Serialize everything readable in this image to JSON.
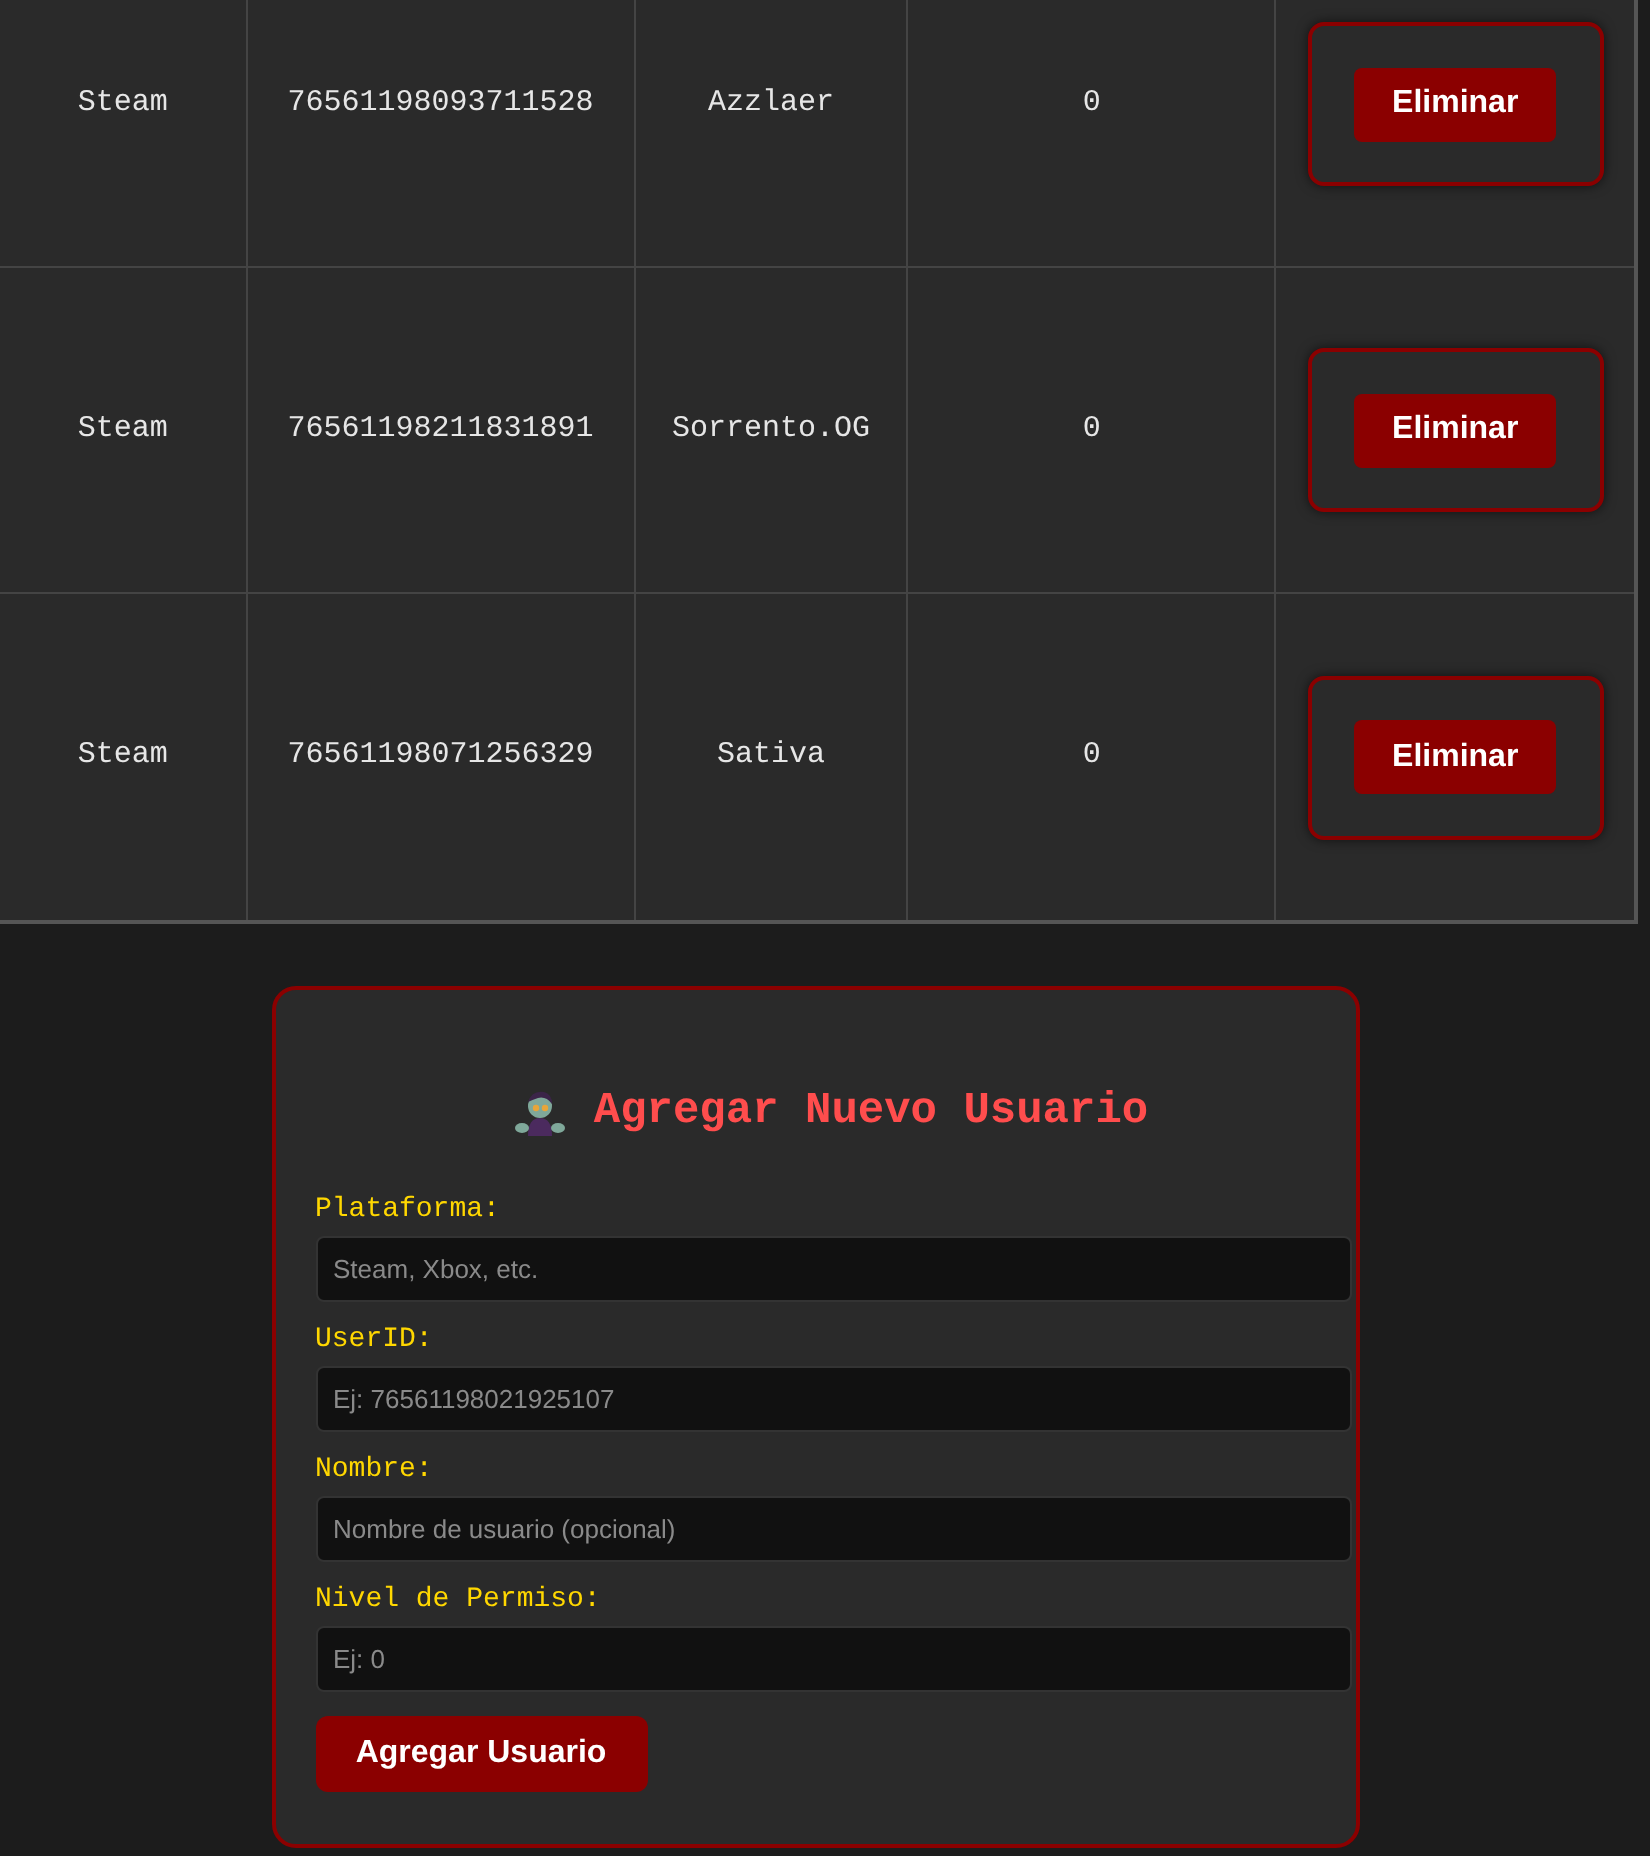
{
  "users": [
    {
      "platform": "Steam",
      "user_id": "76561198093711528",
      "name": "Azzlaer",
      "level_text": "0",
      "action": "Eliminar"
    },
    {
      "platform": "Steam",
      "user_id": "76561198211831891",
      "name": "Sorrento.OG",
      "level_text": "0",
      "action": "Eliminar"
    },
    {
      "platform": "Steam",
      "user_id": "76561198071256329",
      "name": "Sativa",
      "level_text": "0",
      "action": "Eliminar"
    }
  ],
  "form": {
    "title": "Agregar Nuevo Usuario",
    "fields": [
      {
        "label": "Plataforma:",
        "placeholder": "Steam, Xbox, etc."
      },
      {
        "label": "UserID:",
        "placeholder": "Ej: 76561198021925107"
      },
      {
        "label": "Nombre:",
        "placeholder": "Nombre de usuario (opcional)"
      },
      {
        "label": "Nivel de Permiso:",
        "placeholder": "Ej: 0"
      }
    ],
    "submit": "Agregar Usuario"
  }
}
